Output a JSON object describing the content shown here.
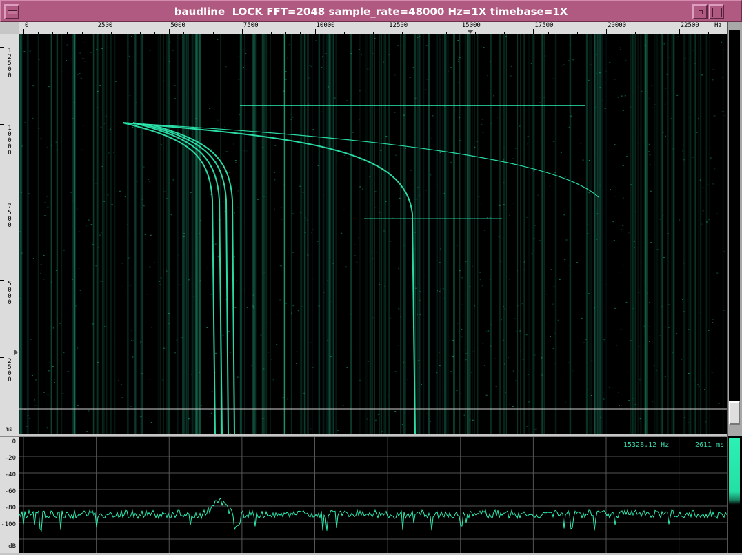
{
  "window": {
    "title": "baudline  LOCK FFT=2048 sample_rate=48000 Hz=1X timebase=1X",
    "accent_color": "#b05a82",
    "signal_color": "#2ef0b4"
  },
  "freq_axis": {
    "unit": "Hz",
    "ticks": [
      "0",
      "2500",
      "5000",
      "7500",
      "10000",
      "12500",
      "15000",
      "17500",
      "20000",
      "22500"
    ],
    "max_hz": 24000,
    "marker_hz": 15328
  },
  "time_axis": {
    "unit": "ms",
    "ticks": [
      "12500",
      "10000",
      "7500",
      "5000",
      "2500"
    ]
  },
  "spectrum": {
    "db_unit": "dB",
    "db_ticks": [
      "0",
      "-20",
      "-40",
      "-60",
      "-80",
      "-100"
    ],
    "cursor_freq": "15328.12 Hz",
    "cursor_time": "2611 ms"
  },
  "icons": {
    "menu": "window-menu-icon",
    "minimize": "minimize-icon",
    "maximize": "maximize-icon",
    "close": "close-icon"
  }
}
